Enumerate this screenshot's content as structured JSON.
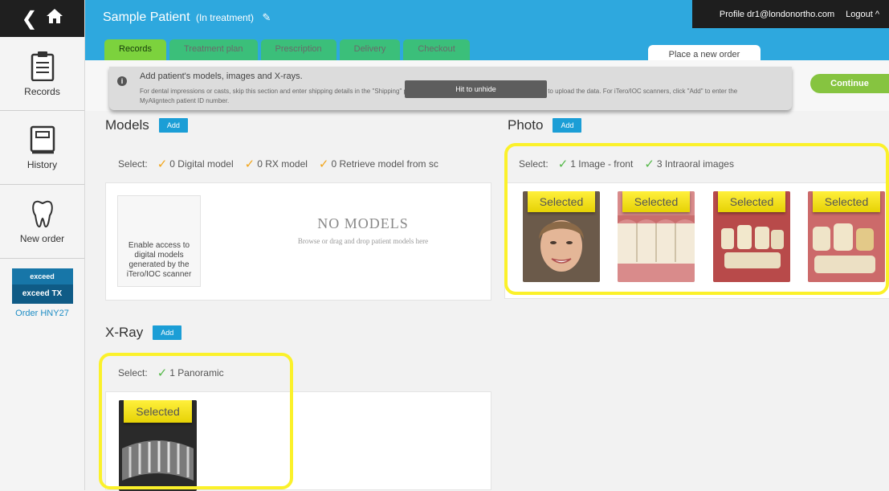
{
  "sidebar": {
    "nav": [
      {
        "label": "Records"
      },
      {
        "label": "History"
      },
      {
        "label": "New order"
      }
    ],
    "exceed": {
      "line1": "exceed",
      "line2": "exceed TX",
      "order": "Order HNY27"
    }
  },
  "header": {
    "patient_name": "Sample Patient",
    "patient_status": "(In treatment)",
    "profile": "Profile  dr1@londonortho.com",
    "logout": "Logout ^",
    "tabs": [
      {
        "label": "Records",
        "active": true
      },
      {
        "label": "Treatment plan",
        "active": false
      },
      {
        "label": "Prescription",
        "active": false
      },
      {
        "label": "Delivery",
        "active": false
      },
      {
        "label": "Checkout",
        "active": false
      }
    ],
    "place_order": "Place a new order"
  },
  "info": {
    "title": "Add patient's models, images and X-rays.",
    "description": "For dental impressions or casts, skip this section and enter shipping details in the \"Shipping\" page. For digital models in STL format, click \"Add\" to upload the data. For iTero/IOC scanners, click \"Add\" to enter the MyAligntech patient ID number.",
    "hit_unhide": "Hit to unhide",
    "continue_label": "Continue"
  },
  "models": {
    "title": "Models",
    "add_label": "Add",
    "select_label": "Select:",
    "options": [
      "0 Digital model",
      "0 RX model",
      "0 Retrieve model from sc"
    ],
    "itero_text": "Enable access to digital models generated by the iTero/IOC scanner",
    "empty_title": "NO MODELS",
    "empty_sub": "Browse or drag and drop patient models here"
  },
  "photo": {
    "title": "Photo",
    "add_label": "Add",
    "select_label": "Select:",
    "options": [
      "1 Image - front",
      "3 Intraoral images"
    ],
    "selected_label": "Selected"
  },
  "xray": {
    "title": "X-Ray",
    "add_label": "Add",
    "select_label": "Select:",
    "options": [
      "1 Panoramic"
    ],
    "selected_label": "Selected"
  },
  "colors": {
    "header_blue": "#2ea8de",
    "tab_green": "#7cd23d",
    "add_blue": "#1b9ed6",
    "highlight_yellow": "#fbf12a",
    "continue_green": "#86c440"
  }
}
